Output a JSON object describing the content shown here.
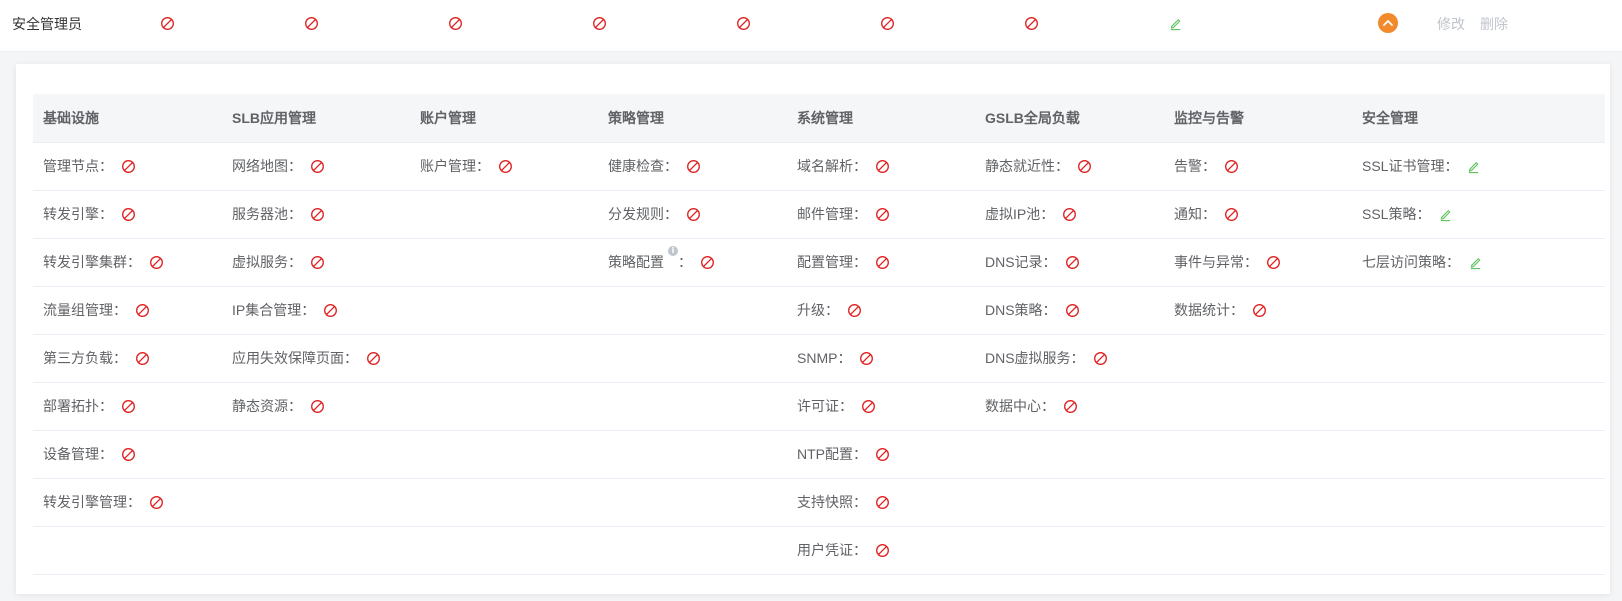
{
  "role": {
    "name": "安全管理员",
    "summary": [
      "deny",
      "deny",
      "deny",
      "deny",
      "deny",
      "deny",
      "deny",
      "edit"
    ],
    "actions": {
      "edit_label": "修改",
      "delete_label": "删除"
    }
  },
  "colors": {
    "deny": "#e02020",
    "edit": "#5cc25c",
    "accent": "#f08a2a"
  },
  "icons": {
    "deny": "no-permission-icon",
    "edit": "edit-permission-icon",
    "expand": "chevron-up-icon",
    "info": "info-icon"
  },
  "columns": [
    {
      "header": "基础设施",
      "items": [
        {
          "label": "管理节点：",
          "perm": "deny"
        },
        {
          "label": "转发引擎：",
          "perm": "deny"
        },
        {
          "label": "转发引擎集群：",
          "perm": "deny"
        },
        {
          "label": "流量组管理：",
          "perm": "deny"
        },
        {
          "label": "第三方负载：",
          "perm": "deny"
        },
        {
          "label": "部署拓扑：",
          "perm": "deny"
        },
        {
          "label": "设备管理：",
          "perm": "deny"
        },
        {
          "label": "转发引擎管理：",
          "perm": "deny"
        }
      ]
    },
    {
      "header": "SLB应用管理",
      "items": [
        {
          "label": "网络地图：",
          "perm": "deny"
        },
        {
          "label": "服务器池：",
          "perm": "deny"
        },
        {
          "label": "虚拟服务：",
          "perm": "deny"
        },
        {
          "label": "IP集合管理：",
          "perm": "deny"
        },
        {
          "label": "应用失效保障页面：",
          "perm": "deny"
        },
        {
          "label": "静态资源：",
          "perm": "deny"
        }
      ]
    },
    {
      "header": "账户管理",
      "items": [
        {
          "label": "账户管理：",
          "perm": "deny"
        }
      ]
    },
    {
      "header": "策略管理",
      "items": [
        {
          "label": "健康检查：",
          "perm": "deny"
        },
        {
          "label": "分发规则：",
          "perm": "deny"
        },
        {
          "label": "策略配置",
          "suffix": "：",
          "info": "i",
          "perm": "deny"
        }
      ]
    },
    {
      "header": "系统管理",
      "items": [
        {
          "label": "域名解析：",
          "perm": "deny"
        },
        {
          "label": "邮件管理：",
          "perm": "deny"
        },
        {
          "label": "配置管理：",
          "perm": "deny"
        },
        {
          "label": "升级：",
          "perm": "deny"
        },
        {
          "label": "SNMP：",
          "perm": "deny"
        },
        {
          "label": "许可证：",
          "perm": "deny"
        },
        {
          "label": "NTP配置：",
          "perm": "deny"
        },
        {
          "label": "支持快照：",
          "perm": "deny"
        },
        {
          "label": "用户凭证：",
          "perm": "deny"
        }
      ]
    },
    {
      "header": "GSLB全局负载",
      "items": [
        {
          "label": "静态就近性：",
          "perm": "deny"
        },
        {
          "label": "虚拟IP池：",
          "perm": "deny"
        },
        {
          "label": "DNS记录：",
          "perm": "deny"
        },
        {
          "label": "DNS策略：",
          "perm": "deny"
        },
        {
          "label": "DNS虚拟服务：",
          "perm": "deny"
        },
        {
          "label": "数据中心：",
          "perm": "deny"
        }
      ]
    },
    {
      "header": "监控与告警",
      "items": [
        {
          "label": "告警：",
          "perm": "deny"
        },
        {
          "label": "通知：",
          "perm": "deny"
        },
        {
          "label": "事件与异常：",
          "perm": "deny"
        },
        {
          "label": "数据统计：",
          "perm": "deny"
        }
      ]
    },
    {
      "header": "安全管理",
      "items": [
        {
          "label": "SSL证书管理：",
          "perm": "edit"
        },
        {
          "label": "SSL策略：",
          "perm": "edit"
        },
        {
          "label": "七层访问策略：",
          "perm": "edit"
        }
      ]
    }
  ]
}
